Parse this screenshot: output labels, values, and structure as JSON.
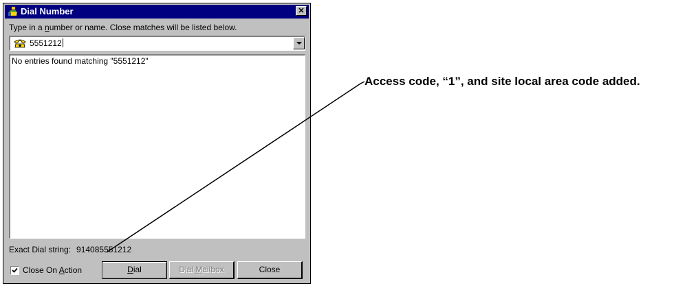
{
  "window": {
    "title": "Dial Number",
    "close_glyph": "✕"
  },
  "prompt": {
    "before": "Type in a ",
    "accel": "n",
    "after": "umber or name.  Close matches will be listed below."
  },
  "combo": {
    "icon": "phone-icon",
    "value": "5551212"
  },
  "results": {
    "message": "No entries found matching \"5551212\""
  },
  "dial_string": {
    "label": "Exact Dial string:",
    "value": "914085551212"
  },
  "close_on_action": {
    "checked": true,
    "label_before": "Close On ",
    "accel": "A",
    "label_after": "ction"
  },
  "buttons": {
    "dial": {
      "accel": "D",
      "rest": "ial"
    },
    "dial_mailbox": {
      "before": "Dial ",
      "accel": "M",
      "after": "ailbox"
    },
    "close": "Close"
  },
  "annotation": "Access code, “1”, and site local area code added.",
  "colors": {
    "title_bar": "#000080",
    "face": "#c0c0c0"
  }
}
